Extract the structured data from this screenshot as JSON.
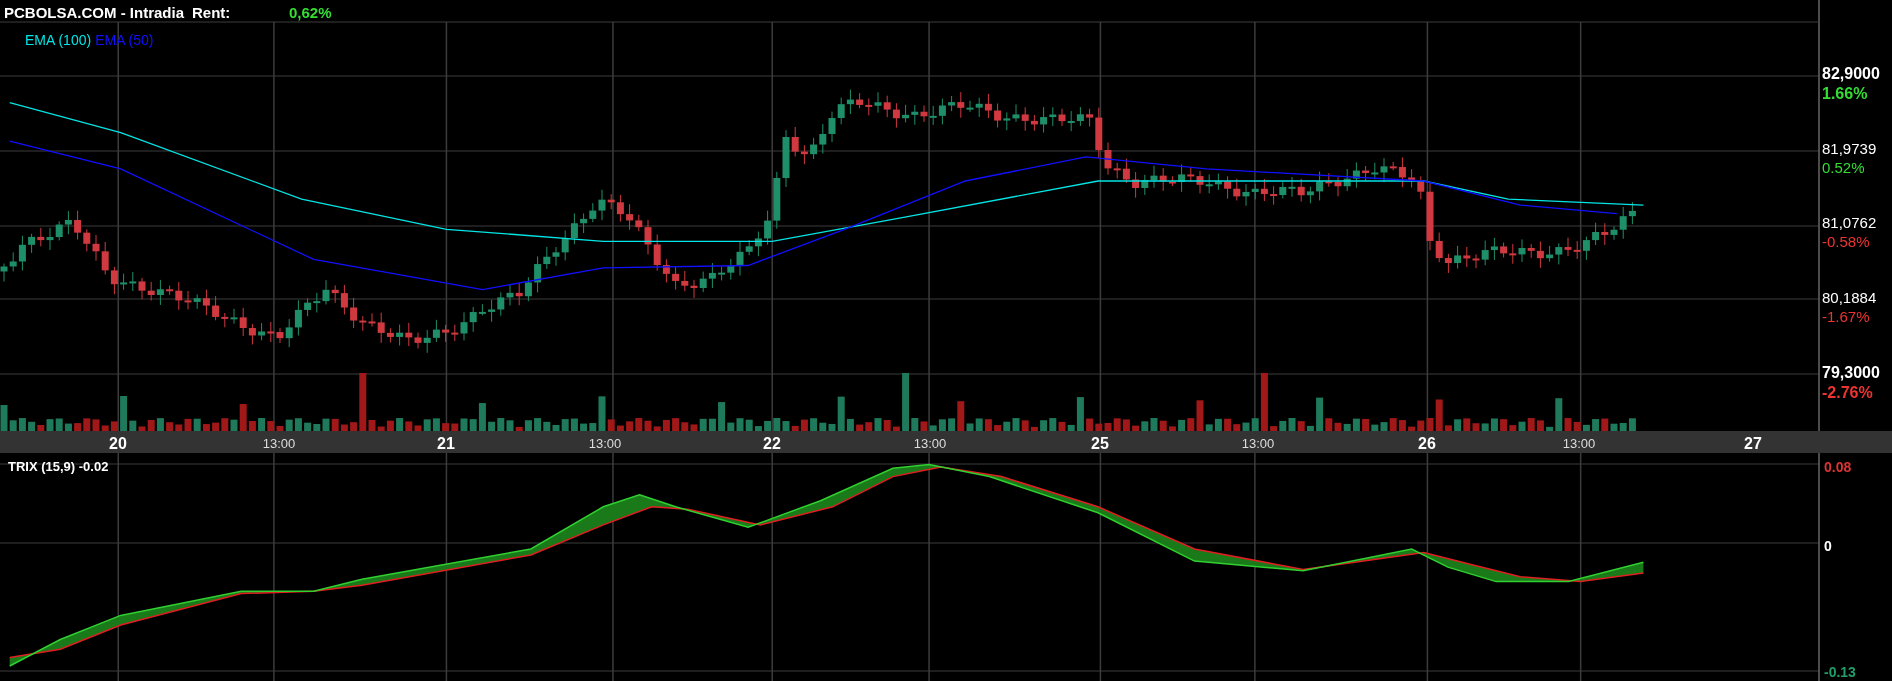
{
  "header": {
    "title": "PCBOLSA.COM - Intradia",
    "rent_label": "Rent:",
    "rent_value": "0,62%"
  },
  "legend": [
    {
      "label": "EMA (100)",
      "color": "#00e5e5"
    },
    {
      "label": "EMA (50)",
      "color": "#1010ff"
    }
  ],
  "price_axis": [
    {
      "price": "82,9000",
      "change": "1.66%",
      "gain": true,
      "emphasis": true
    },
    {
      "price": "81,9739",
      "change": "0.52%",
      "gain": true,
      "emphasis": false
    },
    {
      "price": "81,0762",
      "change": "-0.58%",
      "gain": false,
      "emphasis": false
    },
    {
      "price": "80,1884",
      "change": "-1.67%",
      "gain": false,
      "emphasis": false
    },
    {
      "price": "79,3000",
      "change": "-2.76%",
      "gain": false,
      "emphasis": true
    }
  ],
  "time_axis": [
    {
      "label": "20",
      "kind": "day"
    },
    {
      "label": "13:00",
      "kind": "time"
    },
    {
      "label": "21",
      "kind": "day"
    },
    {
      "label": "13:00",
      "kind": "time"
    },
    {
      "label": "22",
      "kind": "day"
    },
    {
      "label": "13:00",
      "kind": "time"
    },
    {
      "label": "25",
      "kind": "day"
    },
    {
      "label": "13:00",
      "kind": "time"
    },
    {
      "label": "26",
      "kind": "day"
    },
    {
      "label": "13:00",
      "kind": "time"
    },
    {
      "label": "27",
      "kind": "day"
    }
  ],
  "trix": {
    "label": "TRIX (15,9) -0.02",
    "axis": [
      {
        "label": "0.08",
        "kind": "high"
      },
      {
        "label": "0",
        "kind": "zero"
      },
      {
        "label": "-0.13",
        "kind": "low"
      }
    ]
  }
}
